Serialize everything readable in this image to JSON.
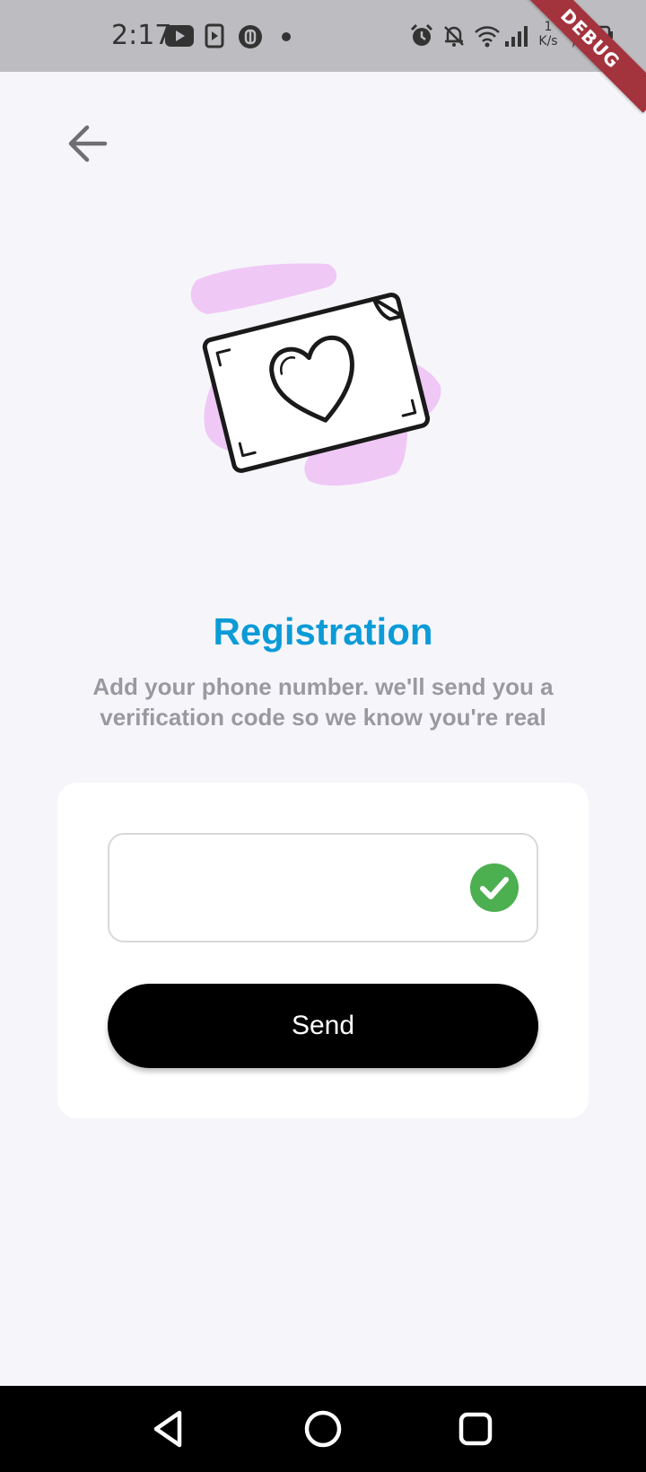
{
  "status_bar": {
    "time": "2:17",
    "net_speed_value": "1",
    "net_speed_unit": "K/s",
    "debug_label": "DEBUG"
  },
  "header": {
    "back_icon": "arrow-left-icon"
  },
  "illustration": {
    "icon": "love-letter-illustration",
    "accent_color": "#f0c8f6"
  },
  "content": {
    "title": "Registration",
    "subtitle": "Add your phone number. we'll send you a verification code so we know you're real"
  },
  "form": {
    "phone_value": "",
    "phone_placeholder": "",
    "valid_icon": "check-circle-icon",
    "send_label": "Send"
  },
  "colors": {
    "title": "#0b9bd7",
    "subtitle": "#9a99a1",
    "check": "#4caf50",
    "button": "#000000",
    "background": "#f6f6fa"
  }
}
